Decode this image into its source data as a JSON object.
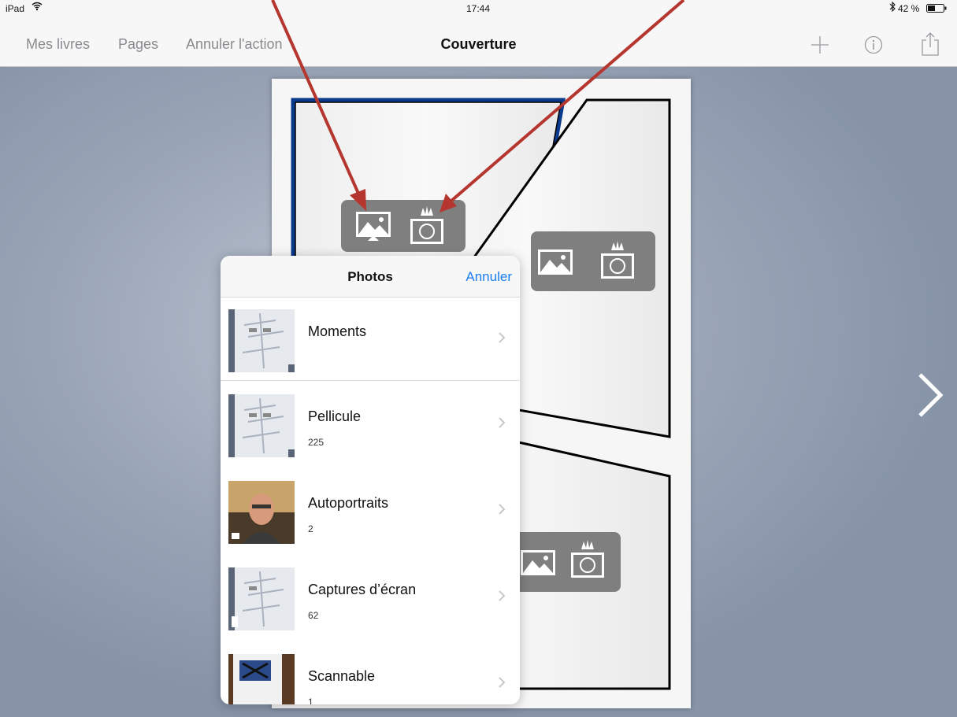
{
  "status_bar": {
    "device": "iPad",
    "time": "17:44",
    "battery": "42 %"
  },
  "nav": {
    "back_label": "Mes livres",
    "pages_label": "Pages",
    "undo_label": "Annuler l'action",
    "title": "Couverture"
  },
  "popover": {
    "title": "Photos",
    "cancel_label": "Annuler",
    "albums": [
      {
        "name": "Moments",
        "count": ""
      },
      {
        "name": "Pellicule",
        "count": "225"
      },
      {
        "name": "Autoportraits",
        "count": "2"
      },
      {
        "name": "Captures d’écran",
        "count": "62"
      },
      {
        "name": "Scannable",
        "count": "1"
      }
    ]
  },
  "colors": {
    "accent": "#1a7ef0",
    "annotation_arrow": "#b5352f",
    "workspace": "#8794a8",
    "selected_panel_border": "#0a3a8c"
  },
  "icons": [
    "wifi-icon",
    "bluetooth-icon",
    "battery-icon",
    "plus-icon",
    "info-icon",
    "share-icon",
    "photo-library-icon",
    "camera-icon",
    "chevron-right-icon"
  ]
}
